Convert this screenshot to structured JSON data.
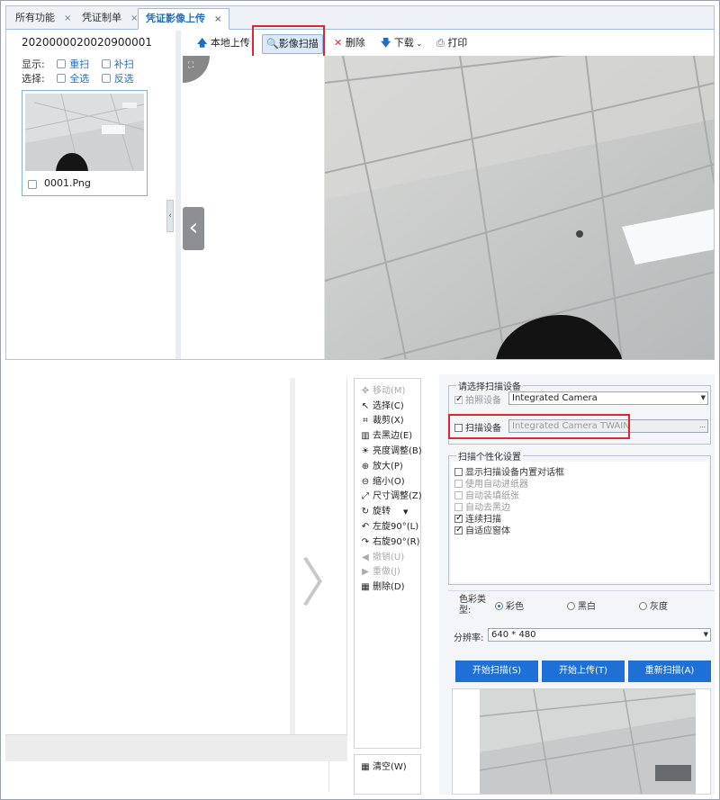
{
  "tabs": [
    {
      "label": "所有功能"
    },
    {
      "label": "凭证制单"
    },
    {
      "label": "凭证影像上传"
    }
  ],
  "tab_close": "×",
  "left": {
    "voucher_no": "2020000020020900001",
    "display_label": "显示:",
    "select_label": "选择:",
    "rescan": "重扫",
    "supplement": "补扫",
    "select_all": "全选",
    "invert": "反选",
    "thumb_name": "0001.Png"
  },
  "toolbar": {
    "upload": "本地上传",
    "scan": "影像扫描",
    "delete": "删除",
    "download": "下载",
    "print": "打印"
  },
  "tools": [
    {
      "label": "移动(M)",
      "icon": "✥",
      "disabled": true
    },
    {
      "label": "选择(C)",
      "icon": "↖",
      "disabled": false
    },
    {
      "label": "裁剪(X)",
      "icon": "⌗",
      "disabled": false
    },
    {
      "label": "去黑边(E)",
      "icon": "▥",
      "disabled": false
    },
    {
      "label": "亮度调整(B)",
      "icon": "☀",
      "disabled": false
    },
    {
      "label": "放大(P)",
      "icon": "⊕",
      "disabled": false
    },
    {
      "label": "缩小(O)",
      "icon": "⊖",
      "disabled": false
    },
    {
      "label": "尺寸调整(Z)",
      "icon": "⤢",
      "disabled": false
    },
    {
      "label": "旋转",
      "icon": "↻",
      "disabled": false
    },
    {
      "label": "左旋90°(L)",
      "icon": "↶",
      "disabled": false
    },
    {
      "label": "右旋90°(R)",
      "icon": "↷",
      "disabled": false
    },
    {
      "label": "撤销(U)",
      "icon": "◀",
      "disabled": true
    },
    {
      "label": "重做(J)",
      "icon": "▶",
      "disabled": true
    },
    {
      "label": "删除(D)",
      "icon": "▦",
      "disabled": false
    }
  ],
  "clear": "清空(W)",
  "device": {
    "group_title": "请选择扫描设备",
    "camera_label": "拍照设备",
    "camera_value": "Integrated Camera",
    "scanner_label": "扫描设备",
    "scanner_value": "Integrated Camera TWAIN"
  },
  "settings": {
    "group_title": "扫描个性化设置",
    "items": [
      {
        "label": "显示扫描设备内置对话框",
        "checked": false,
        "disabled": false
      },
      {
        "label": "使用自动进纸器",
        "checked": false,
        "disabled": true
      },
      {
        "label": "自动装填纸张",
        "checked": false,
        "disabled": true
      },
      {
        "label": "自动去黑边",
        "checked": false,
        "disabled": true
      },
      {
        "label": "连续扫描",
        "checked": true,
        "disabled": false
      },
      {
        "label": "自适应窗体",
        "checked": true,
        "disabled": false
      }
    ]
  },
  "color": {
    "label": "色彩类型:",
    "options": [
      "彩色",
      "黑白",
      "灰度"
    ],
    "selected": "彩色"
  },
  "resolution": {
    "label": "分辨率:",
    "value": "640 * 480"
  },
  "buttons": {
    "start_scan": "开始扫描(S)",
    "start_upload": "开始上传(T)",
    "rescan": "重新扫描(A)"
  },
  "colors": {
    "accent": "#1f6fc5",
    "button_blue": "#1e6fd6",
    "highlight_red": "#e0262e"
  }
}
